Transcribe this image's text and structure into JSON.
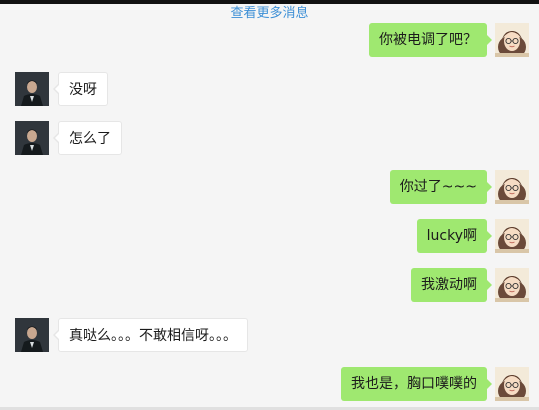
{
  "header": {
    "more_messages": "查看更多消息"
  },
  "messages": [
    {
      "side": "out",
      "text": "你被电调了吧？"
    },
    {
      "side": "in",
      "text": "没呀"
    },
    {
      "side": "in",
      "text": "怎么了"
    },
    {
      "side": "out",
      "text": "你过了~~~"
    },
    {
      "side": "out",
      "text": "lucky啊"
    },
    {
      "side": "out",
      "text": "我激动啊"
    },
    {
      "side": "in",
      "text": "真哒么。。。不敢相信呀。。。"
    },
    {
      "side": "out",
      "text": "我也是，胸口噗噗的"
    }
  ],
  "colors": {
    "outgoing_bubble": "#9fe870",
    "incoming_bubble": "#ffffff",
    "link": "#3c8fd6",
    "background": "#f5f5f5"
  },
  "icons": {
    "self_avatar": "girl-with-glasses-avatar",
    "other_avatar": "man-in-suit-avatar"
  }
}
